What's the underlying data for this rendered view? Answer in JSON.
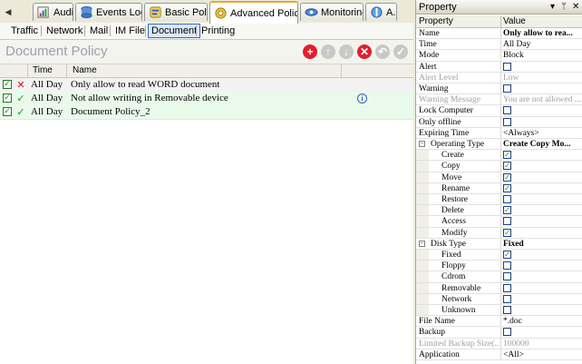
{
  "tabs": [
    {
      "label": "Audit"
    },
    {
      "label": "Events Log"
    },
    {
      "label": "Basic Policy"
    },
    {
      "label": "Advanced Policy"
    },
    {
      "label": "Monitoring"
    },
    {
      "label": "A..."
    }
  ],
  "subtabs": [
    "Traffic",
    "Network",
    "Mail",
    "IM File",
    "Document",
    "Printing"
  ],
  "header": {
    "title": "Document Policy"
  },
  "grid": {
    "columns": {
      "time": "Time",
      "name": "Name"
    },
    "rows": [
      {
        "status": "✕",
        "time": "All Day",
        "name": "Only allow to read WORD document"
      },
      {
        "status": "✓",
        "time": "All Day",
        "name": "Not allow writing in Removable device"
      },
      {
        "status": "✓",
        "time": "All Day",
        "name": "Document Policy_2"
      }
    ]
  },
  "property": {
    "title": "Property",
    "pin": "▾",
    "pin2": "ᛘ",
    "close": "✕",
    "col_property": "Property",
    "col_value": "Value",
    "rows": [
      {
        "name": "Name",
        "value": "Only allow to rea..."
      },
      {
        "name": "Time",
        "value": "All Day"
      },
      {
        "name": "Mode",
        "value": "Block"
      },
      {
        "name": "Alert",
        "value": ""
      },
      {
        "name": "Alert Level",
        "value": "Low"
      },
      {
        "name": "Warning",
        "value": ""
      },
      {
        "name": "Warning Message",
        "value": "You are not allowed ..."
      },
      {
        "name": "Lock Computer",
        "value": ""
      },
      {
        "name": "Only offline",
        "value": ""
      },
      {
        "name": "Expiring Time",
        "value": "<Always>"
      },
      {
        "name": "Operating Type",
        "value": "Create Copy Mo..."
      },
      {
        "name": "Create",
        "value": "✓"
      },
      {
        "name": "Copy",
        "value": "✓"
      },
      {
        "name": "Move",
        "value": "✓"
      },
      {
        "name": "Rename",
        "value": "✓"
      },
      {
        "name": "Restore",
        "value": ""
      },
      {
        "name": "Delete",
        "value": "✓"
      },
      {
        "name": "Access",
        "value": ""
      },
      {
        "name": "Modify",
        "value": "✓"
      },
      {
        "name": "Disk Type",
        "value": "Fixed"
      },
      {
        "name": "Fixed",
        "value": "✓"
      },
      {
        "name": "Floppy",
        "value": ""
      },
      {
        "name": "Cdrom",
        "value": ""
      },
      {
        "name": "Removable",
        "value": ""
      },
      {
        "name": "Network",
        "value": ""
      },
      {
        "name": "Unknown",
        "value": ""
      },
      {
        "name": "File Name",
        "value": "*.doc"
      },
      {
        "name": "Backup",
        "value": ""
      },
      {
        "name": "Limited Backup Size(...",
        "value": "100000"
      },
      {
        "name": "Application",
        "value": "<All>"
      }
    ]
  },
  "ui": {
    "scroll_left": "◀",
    "minus": "−",
    "tb_add": "+",
    "tb_up": "↑",
    "tb_down": "↓",
    "tb_del": "✕",
    "tb_undo": "↶",
    "tb_ok": "✓",
    "check": "✓",
    "info": "i"
  },
  "colors": {
    "accent": "#e8a53b",
    "selection": "#316ac5",
    "delete_red": "#e0202a",
    "ok_green": "#1a9a1a"
  }
}
